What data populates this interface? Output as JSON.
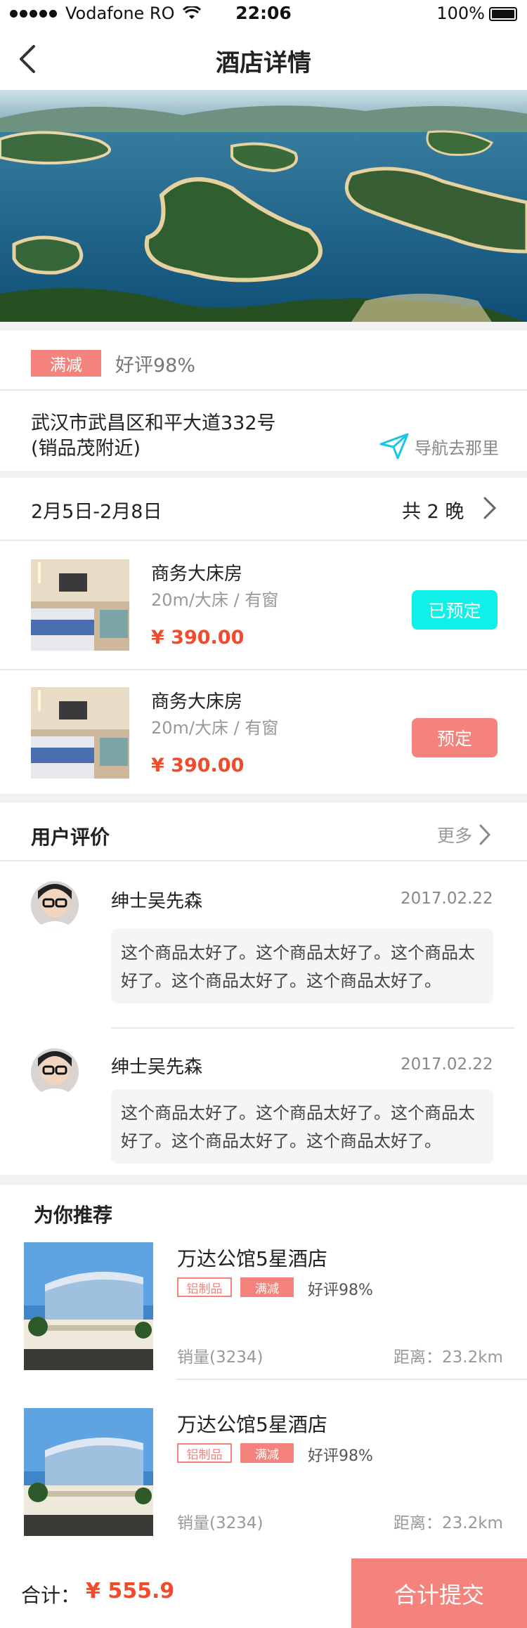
{
  "status_bar": {
    "carrier": "Vodafone RO",
    "time": "22:06",
    "battery": "100%"
  },
  "nav": {
    "title": "酒店详情"
  },
  "hotel": {
    "promo_tag": "满减",
    "rating": "好评98%",
    "address_line1": "武汉市武昌区和平大道332号",
    "address_line2": "(销品茂附近)",
    "navigate_label": "导航去那里"
  },
  "stay": {
    "dates": "2月5日-2月8日",
    "nights": "共 2 晚"
  },
  "rooms": [
    {
      "name": "商务大床房",
      "spec": "20m/大床 / 有窗",
      "price": "¥ 390.00",
      "action": "已预定"
    },
    {
      "name": "商务大床房",
      "spec": "20m/大床 / 有窗",
      "price": "¥ 390.00",
      "action": "预定"
    }
  ],
  "reviews_section": {
    "title": "用户评价",
    "more": "更多"
  },
  "reviews": [
    {
      "user": "绅士吴先森",
      "date": "2017.02.22",
      "text": "这个商品太好了。这个商品太好了。这个商品太好了。这个商品太好了。这个商品太好了。"
    },
    {
      "user": "绅士吴先森",
      "date": "2017.02.22",
      "text": "这个商品太好了。这个商品太好了。这个商品太好了。这个商品太好了。这个商品太好了。"
    }
  ],
  "recommend_section": {
    "title": "为你推荐"
  },
  "recommendations": [
    {
      "name": "万达公馆5星酒店",
      "tag1": "铝制品",
      "tag2": "满减",
      "rating": "好评98%",
      "sales": "销量(3234)",
      "distance": "距离：23.2km"
    },
    {
      "name": "万达公馆5星酒店",
      "tag1": "铝制品",
      "tag2": "满减",
      "rating": "好评98%",
      "sales": "销量(3234)",
      "distance": "距离：23.2km"
    }
  ],
  "footer": {
    "total_label": "合计：",
    "total_value": "¥ 555.9",
    "submit_label": "合计提交"
  },
  "colors": {
    "accent": "#f3837c",
    "price": "#f24a2b",
    "booked": "#0ef0e8",
    "navigate_icon": "#19c6e6"
  }
}
